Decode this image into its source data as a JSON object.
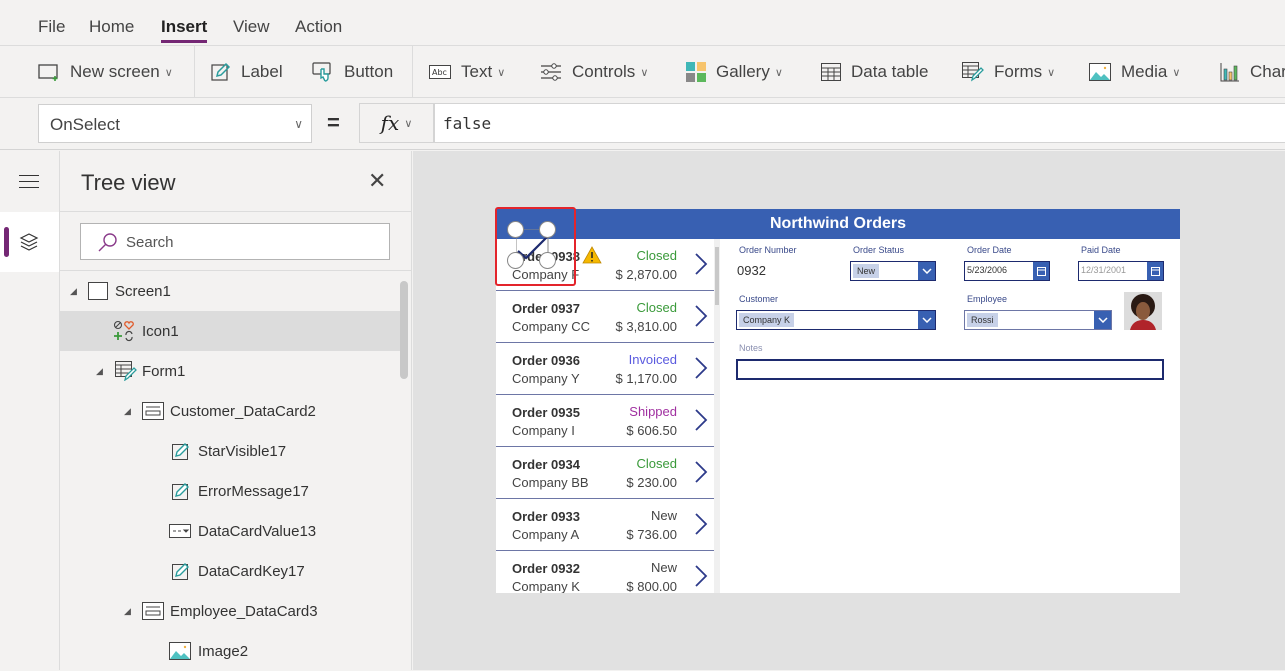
{
  "menu": {
    "items": [
      "File",
      "Home",
      "Insert",
      "View",
      "Action"
    ],
    "active": "Insert"
  },
  "ribbon": {
    "new_screen": "New screen",
    "label": "Label",
    "button": "Button",
    "text": "Text",
    "controls": "Controls",
    "gallery": "Gallery",
    "data_table": "Data table",
    "forms": "Forms",
    "media": "Media",
    "charts": "Charts"
  },
  "formula_bar": {
    "property": "OnSelect",
    "equals": "=",
    "fx_label": "fx",
    "formula": "false"
  },
  "tree_view": {
    "title": "Tree view",
    "search_placeholder": "Search",
    "nodes": [
      {
        "label": "Screen1",
        "icon": "screen-icon",
        "expanded": true,
        "level": 0
      },
      {
        "label": "Icon1",
        "icon": "icons-control-icon",
        "selected": true,
        "level": 1
      },
      {
        "label": "Form1",
        "icon": "form-icon",
        "expanded": true,
        "level": 1
      },
      {
        "label": "Customer_DataCard2",
        "icon": "datacard-icon",
        "expanded": true,
        "level": 2
      },
      {
        "label": "StarVisible17",
        "icon": "label-icon",
        "level": 3
      },
      {
        "label": "ErrorMessage17",
        "icon": "label-icon",
        "level": 3
      },
      {
        "label": "DataCardValue13",
        "icon": "dropdown-icon",
        "level": 3
      },
      {
        "label": "DataCardKey17",
        "icon": "label-icon",
        "level": 3
      },
      {
        "label": "Employee_DataCard3",
        "icon": "datacard-icon",
        "expanded": true,
        "level": 2
      },
      {
        "label": "Image2",
        "icon": "image-icon",
        "level": 3
      }
    ]
  },
  "app": {
    "title": "Northwind Orders",
    "orders": [
      {
        "order": "Order 0938",
        "company": "Company F",
        "status": "Closed",
        "amount": "$ 2,870.00",
        "warning": true
      },
      {
        "order": "Order 0937",
        "company": "Company CC",
        "status": "Closed",
        "amount": "$ 3,810.00"
      },
      {
        "order": "Order 0936",
        "company": "Company Y",
        "status": "Invoiced",
        "amount": "$ 1,170.00"
      },
      {
        "order": "Order 0935",
        "company": "Company I",
        "status": "Shipped",
        "amount": "$ 606.50"
      },
      {
        "order": "Order 0934",
        "company": "Company BB",
        "status": "Closed",
        "amount": "$ 230.00"
      },
      {
        "order": "Order 0933",
        "company": "Company A",
        "status": "New",
        "amount": "$ 736.00"
      },
      {
        "order": "Order 0932",
        "company": "Company K",
        "status": "New",
        "amount": "$ 800.00"
      }
    ],
    "status_colors": {
      "Closed": "#3a9a3a",
      "Invoiced": "#5a5adf",
      "Shipped": "#a030a0",
      "New": "#444444"
    },
    "form": {
      "order_number_label": "Order Number",
      "order_number": "0932",
      "order_status_label": "Order Status",
      "order_status": "New",
      "order_date_label": "Order Date",
      "order_date": "5/23/2006",
      "paid_date_label": "Paid Date",
      "paid_date": "12/31/2001",
      "customer_label": "Customer",
      "customer": "Company K",
      "employee_label": "Employee",
      "employee": "Rossi",
      "notes_label": "Notes",
      "notes": ""
    }
  },
  "colors": {
    "accent": "#742774",
    "app_header": "#3860b2",
    "selection": "#e3242b"
  }
}
